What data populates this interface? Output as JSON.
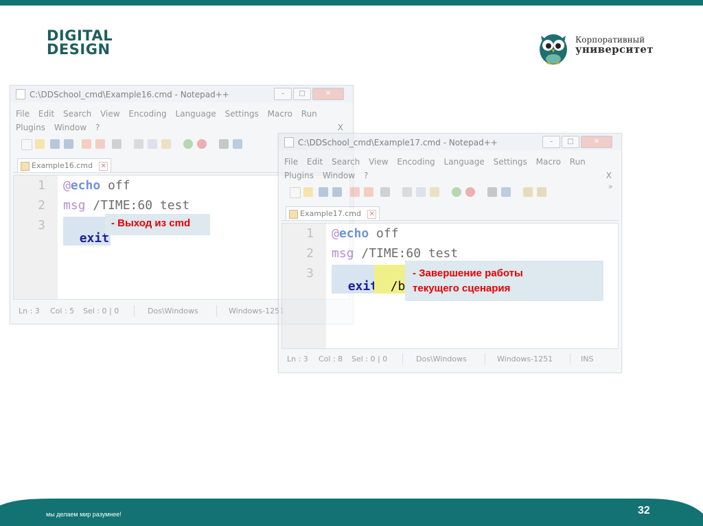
{
  "brand": {
    "logo_line1": "DIGITAL",
    "logo_line2": "DESIGN",
    "university_line1": "Корпоративный",
    "university_line2": "университет"
  },
  "colors": {
    "teal": "#137272",
    "annotation_red": "#e60000",
    "note_bg": "#dde8ef",
    "keyword_blue": "#1a1f99"
  },
  "window1": {
    "title": "C:\\DDSchool_cmd\\Example16.cmd - Notepad++",
    "menu_row1": [
      "File",
      "Edit",
      "Search",
      "View",
      "Encoding",
      "Language",
      "Settings",
      "Macro",
      "Run"
    ],
    "menu_row2": [
      "Plugins",
      "Window",
      "?"
    ],
    "menu_close": "X",
    "tab": "Example16.cmd",
    "line_numbers": [
      "1",
      "2",
      "3"
    ],
    "code": {
      "line1_at": "@",
      "line1_cmd": "echo",
      "line1_arg": " off",
      "line2_cmd": "msg",
      "line2_arg": " /TIME:60 test",
      "line3_cmd": "exit"
    },
    "status": {
      "ln": "Ln : 3",
      "col": "Col : 5",
      "sel": "Sel : 0 | 0",
      "eol": "Dos\\Windows",
      "encoding": "Windows-1251"
    },
    "annotation": "- Выход из cmd"
  },
  "window2": {
    "title": "C:\\DDSchool_cmd\\Example17.cmd - Notepad++",
    "menu_row1": [
      "File",
      "Edit",
      "Search",
      "View",
      "Encoding",
      "Language",
      "Settings",
      "Macro",
      "Run"
    ],
    "menu_row2": [
      "Plugins",
      "Window",
      "?"
    ],
    "menu_close": "X",
    "toolbar_more": "»",
    "tab": "Example17.cmd",
    "line_numbers": [
      "1",
      "2",
      "3"
    ],
    "code": {
      "line1_at": "@",
      "line1_cmd": "echo",
      "line1_arg": " off",
      "line2_cmd": "msg",
      "line2_arg": " /TIME:60 test",
      "line3_cmd": "exit",
      "line3_arg": "/b"
    },
    "status": {
      "ln": "Ln : 3",
      "col": "Col : 8",
      "sel": "Sel : 0 | 0",
      "eol": "Dos\\Windows",
      "encoding": "Windows-1251",
      "mode": "INS"
    },
    "annotation_line1": "- Завершение работы",
    "annotation_line2": "текущего сценария"
  },
  "footer": {
    "slogan": "мы делаем мир разумнее!",
    "page_number": "32"
  }
}
